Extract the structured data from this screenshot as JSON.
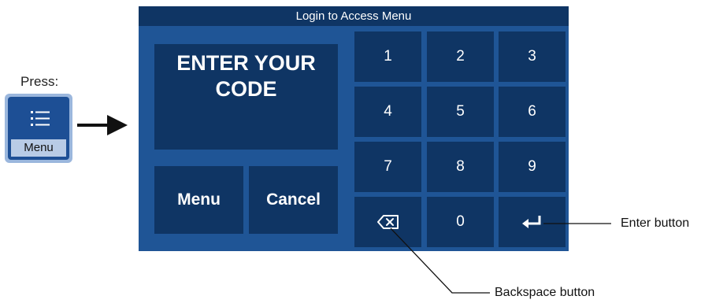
{
  "instruction": {
    "press_label": "Press:",
    "menu_key_caption": "Menu",
    "menu_key_icon": "list-icon"
  },
  "device": {
    "title": "Login to Access Menu",
    "prompt_lines": [
      "ENTER YOUR",
      "CODE"
    ],
    "side_buttons": [
      {
        "label": "Menu"
      },
      {
        "label": "Cancel"
      }
    ],
    "keypad": [
      {
        "label": "1"
      },
      {
        "label": "2"
      },
      {
        "label": "3"
      },
      {
        "label": "4"
      },
      {
        "label": "5"
      },
      {
        "label": "6"
      },
      {
        "label": "7"
      },
      {
        "label": "8"
      },
      {
        "label": "9"
      },
      {
        "icon": "backspace-icon"
      },
      {
        "label": "0"
      },
      {
        "icon": "enter-icon"
      }
    ],
    "colors": {
      "panel": "#1f5596",
      "key": "#0f3564",
      "text": "#ffffff"
    }
  },
  "callouts": {
    "enter": "Enter button",
    "backspace": "Backspace button"
  }
}
